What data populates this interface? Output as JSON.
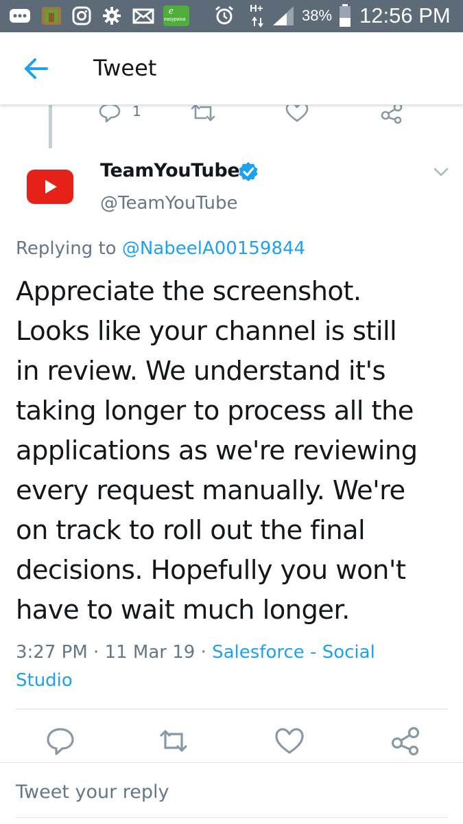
{
  "status_bar": {
    "battery": "38%",
    "time": "12:56 PM",
    "network": "H+",
    "app_icons": [
      "messages-icon",
      "app-icon",
      "instagram-icon",
      "settings-icon",
      "mail-icon",
      "easypaisa-icon"
    ],
    "easypaisa_label": "easypaisa"
  },
  "header": {
    "title": "Tweet"
  },
  "previous_tweet": {
    "reply_count": "1"
  },
  "tweet": {
    "display_name": "TeamYouTube",
    "handle": "@TeamYouTube",
    "replying_prefix": "Replying to",
    "replying_to": "@NabeelA00159844",
    "text_lines": [
      "Appreciate the screenshot.",
      "Looks like your channel is still",
      "in review. We understand it's",
      "taking longer to process all the",
      "applications as we're reviewing",
      "every request manually. We're",
      "on track to roll out the final",
      "decisions. Hopefully you won't",
      "have to wait much longer."
    ],
    "time": "3:27 PM",
    "separator": " · ",
    "date": "11 Mar 19",
    "source_line1": "Salesforce - Social",
    "source_line2": "Studio"
  },
  "reply_box": {
    "placeholder": "Tweet your reply"
  },
  "colors": {
    "status_bar": "#5d6a78",
    "accent": "#1da1f2",
    "secondary_text": "#657786",
    "youtube_red": "#e62117"
  }
}
